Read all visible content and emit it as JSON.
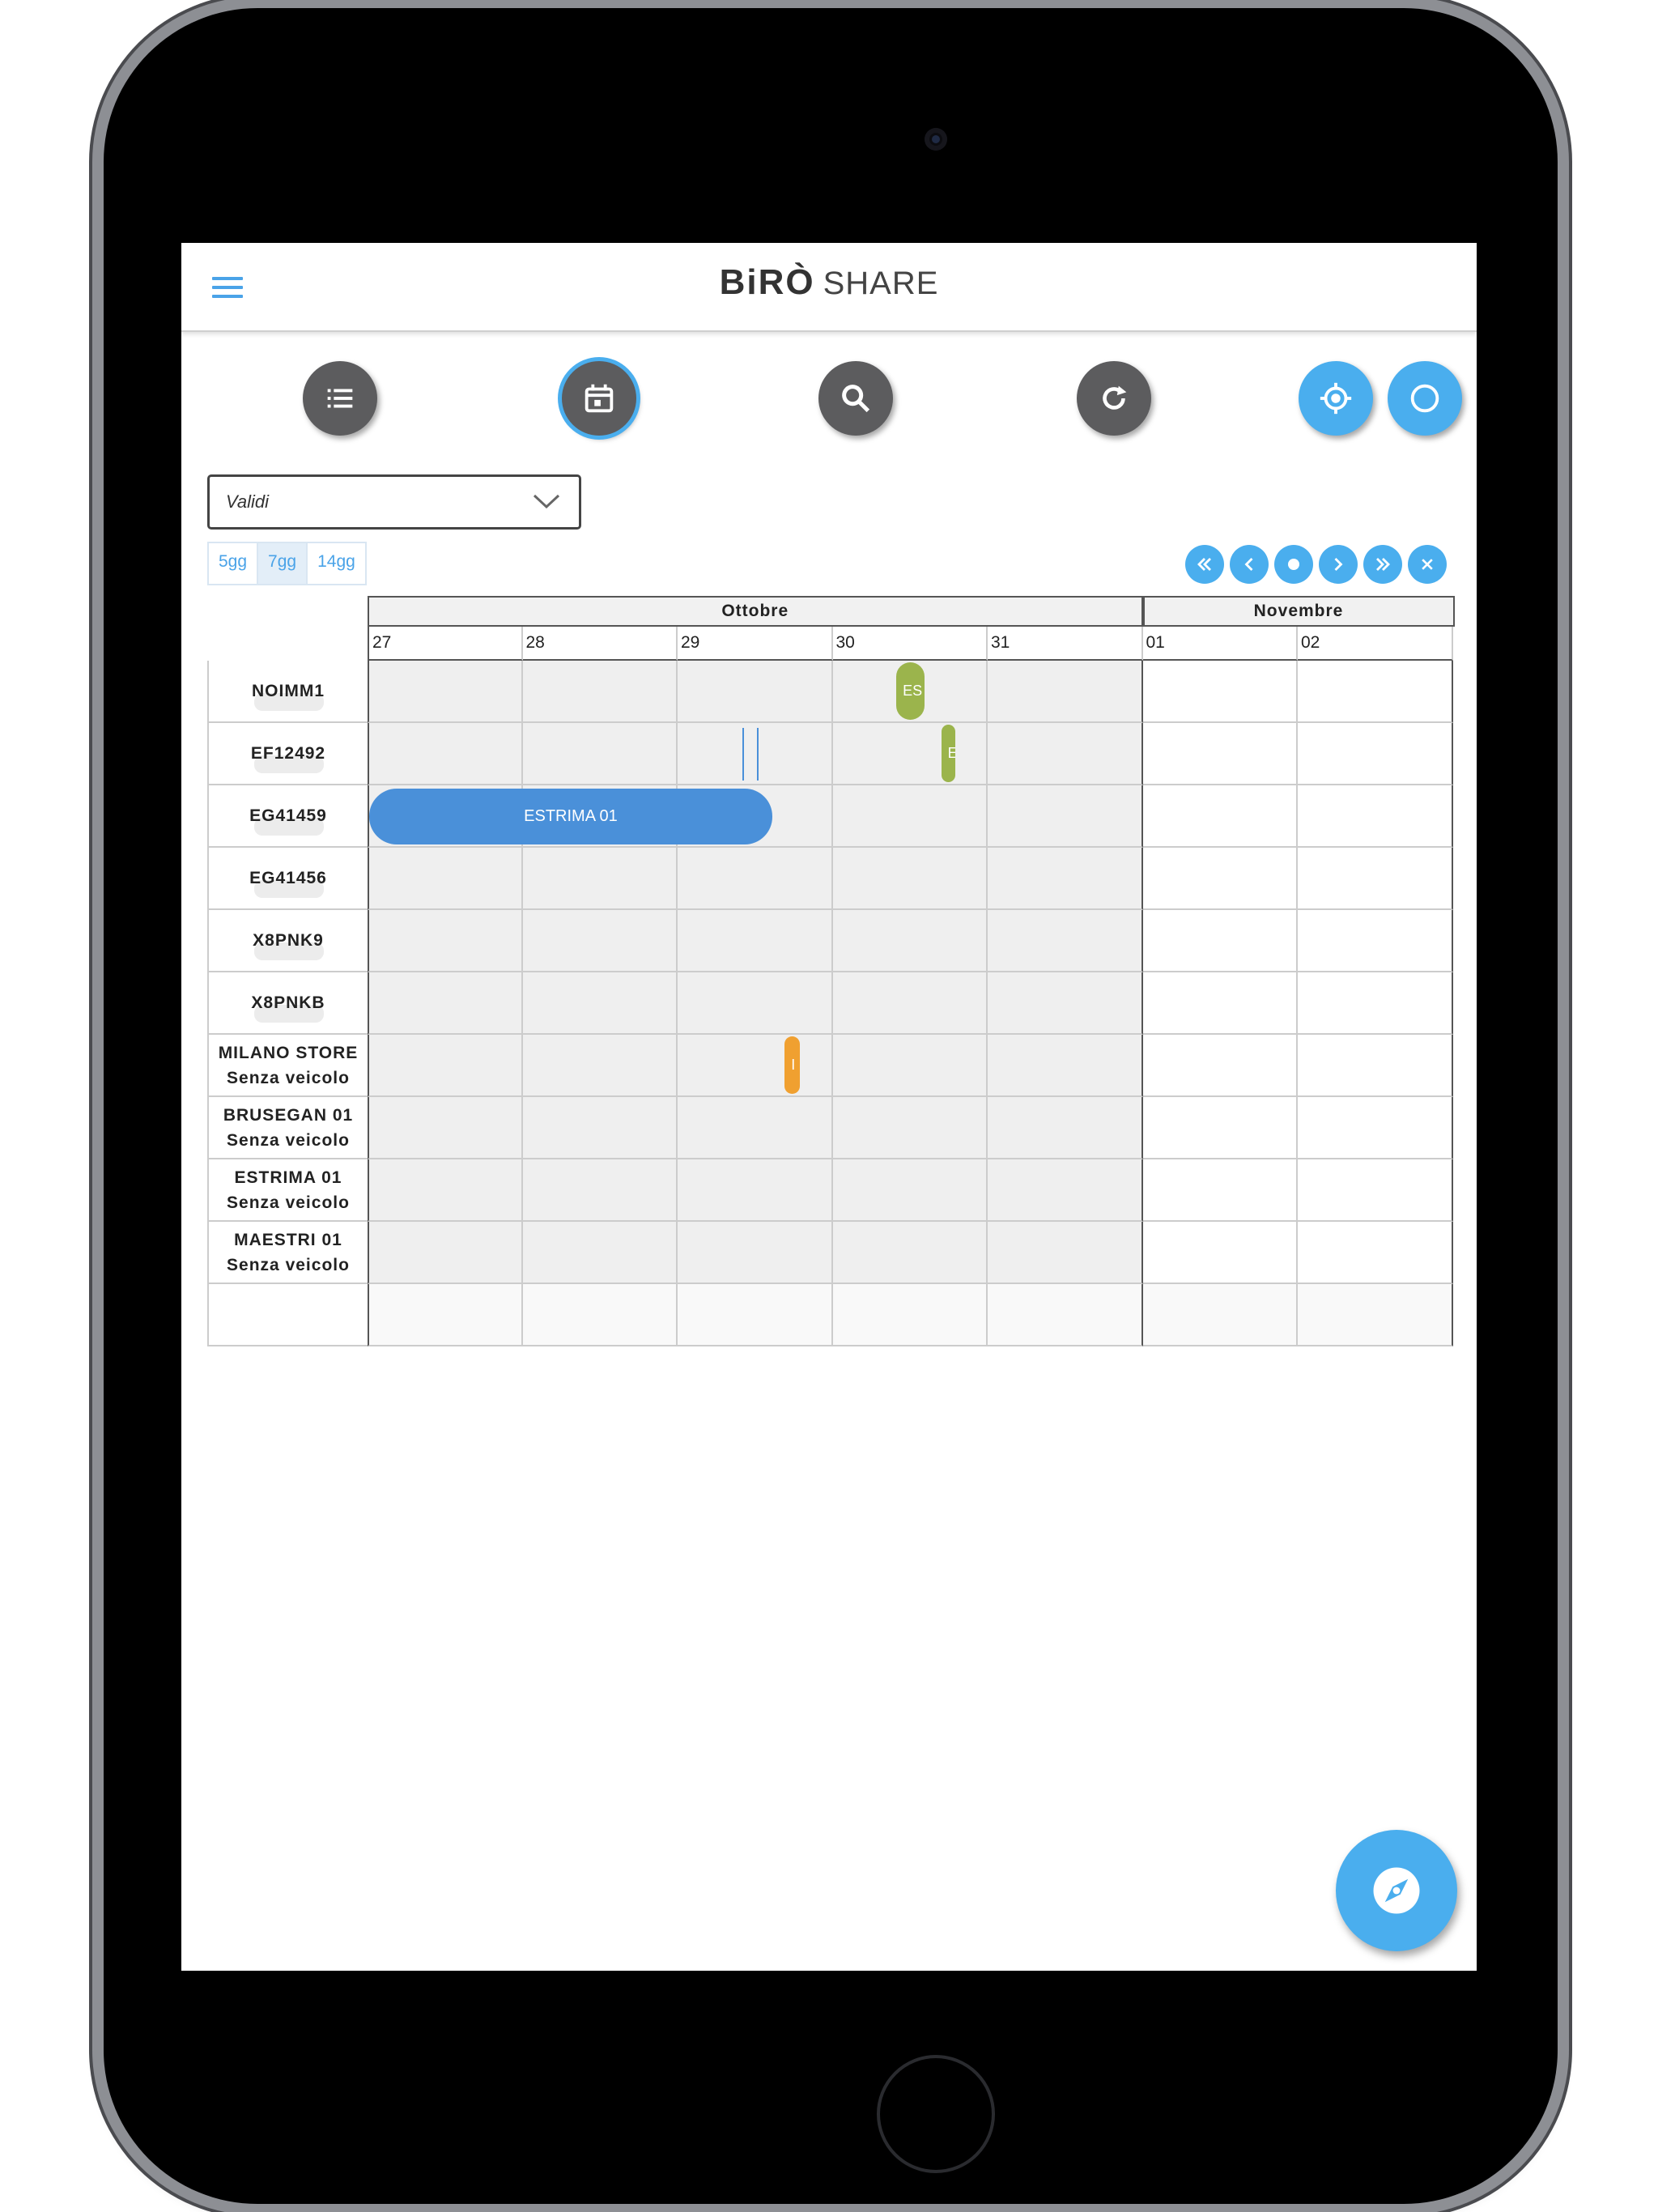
{
  "app": {
    "brand": "BiRÒ",
    "product": "SHARE"
  },
  "icons": {
    "menu": "hamburger-menu-icon",
    "list": "list-icon",
    "calendar": "calendar-icon",
    "search": "search-icon",
    "refresh": "refresh-icon",
    "locate": "gps-locate-icon",
    "circle": "circle-icon",
    "fab": "compass-icon"
  },
  "colors": {
    "accent": "#4aaeee",
    "dark_button": "#5c5c5e",
    "event_blue": "#4a90d9",
    "event_green": "#9bb44c",
    "event_orange": "#f0a030"
  },
  "filter": {
    "selected": "Validi"
  },
  "range_buttons": [
    "5gg",
    "7gg",
    "14gg"
  ],
  "range_active": "7gg",
  "navigation": [
    "first",
    "prev",
    "today",
    "next",
    "last",
    "close"
  ],
  "months": [
    {
      "label": "Ottobre",
      "days": 5
    },
    {
      "label": "Novembre",
      "days": 2
    }
  ],
  "days": [
    "27",
    "28",
    "29",
    "30",
    "31",
    "01",
    "02"
  ],
  "rows": [
    {
      "line1": "NOIMM1",
      "line2": ""
    },
    {
      "line1": "EF12492",
      "line2": ""
    },
    {
      "line1": "EG41459",
      "line2": ""
    },
    {
      "line1": "EG41456",
      "line2": ""
    },
    {
      "line1": "X8PNK9",
      "line2": ""
    },
    {
      "line1": "X8PNKB",
      "line2": ""
    },
    {
      "line1": "MILANO STORE",
      "line2": "Senza veicolo"
    },
    {
      "line1": "BRUSEGAN 01",
      "line2": "Senza veicolo"
    },
    {
      "line1": "ESTRIMA 01",
      "line2": "Senza veicolo"
    },
    {
      "line1": "MAESTRI 01",
      "line2": "Senza veicolo"
    }
  ],
  "events": [
    {
      "row": 0,
      "start_day": 3.4,
      "end_day": 3.58,
      "label": "ES",
      "color": "#9bb44c"
    },
    {
      "row": 1,
      "start_day": 3.69,
      "end_day": 3.78,
      "label": "E",
      "color": "#9bb44c"
    },
    {
      "row": 2,
      "start_day": 0.0,
      "end_day": 2.6,
      "label": "ESTRIMA 01",
      "color": "#4a90d9"
    },
    {
      "row": 6,
      "start_day": 2.68,
      "end_day": 2.78,
      "label": "I",
      "color": "#f0a030"
    }
  ],
  "markers": [
    {
      "row": 1,
      "day": 2.42,
      "color": "#4a90d9"
    },
    {
      "row": 1,
      "day": 2.51,
      "color": "#4a90d9"
    }
  ]
}
